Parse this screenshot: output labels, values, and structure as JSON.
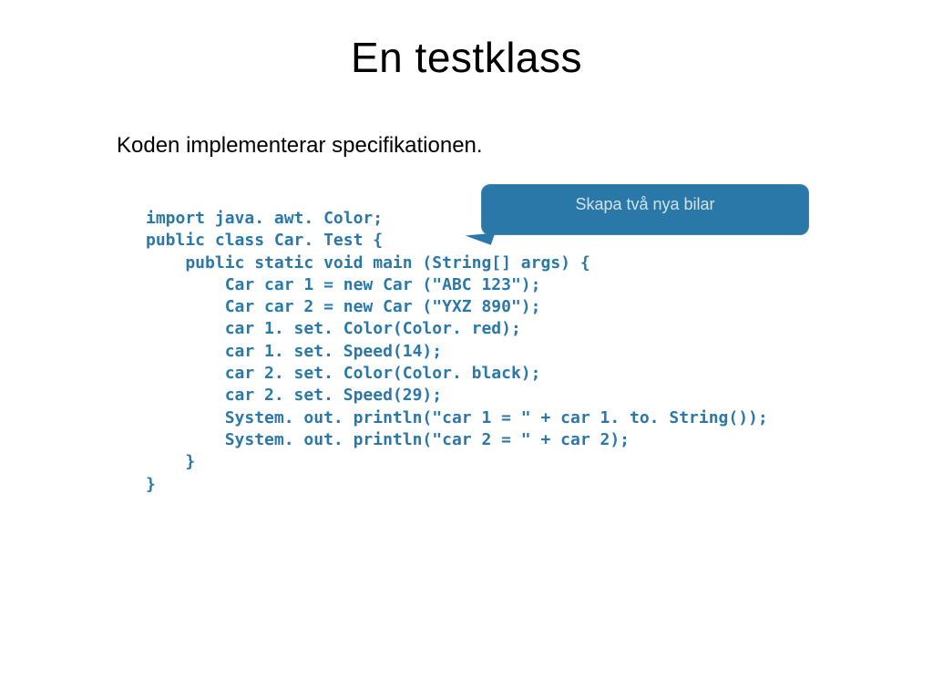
{
  "slide": {
    "title": "En testklass",
    "subtitle": "Koden implementerar specifikationen.",
    "callout_text": "Skapa två nya bilar",
    "code": "import java. awt. Color;\npublic class Car. Test {\n    public static void main (String[] args) {\n        Car car 1 = new Car (\"ABC 123\");\n        Car car 2 = new Car (\"YXZ 890\");\n        car 1. set. Color(Color. red);\n        car 1. set. Speed(14);\n        car 2. set. Color(Color. black);\n        car 2. set. Speed(29);\n        System. out. println(\"car 1 = \" + car 1. to. String());\n        System. out. println(\"car 2 = \" + car 2);\n    }\n}"
  }
}
